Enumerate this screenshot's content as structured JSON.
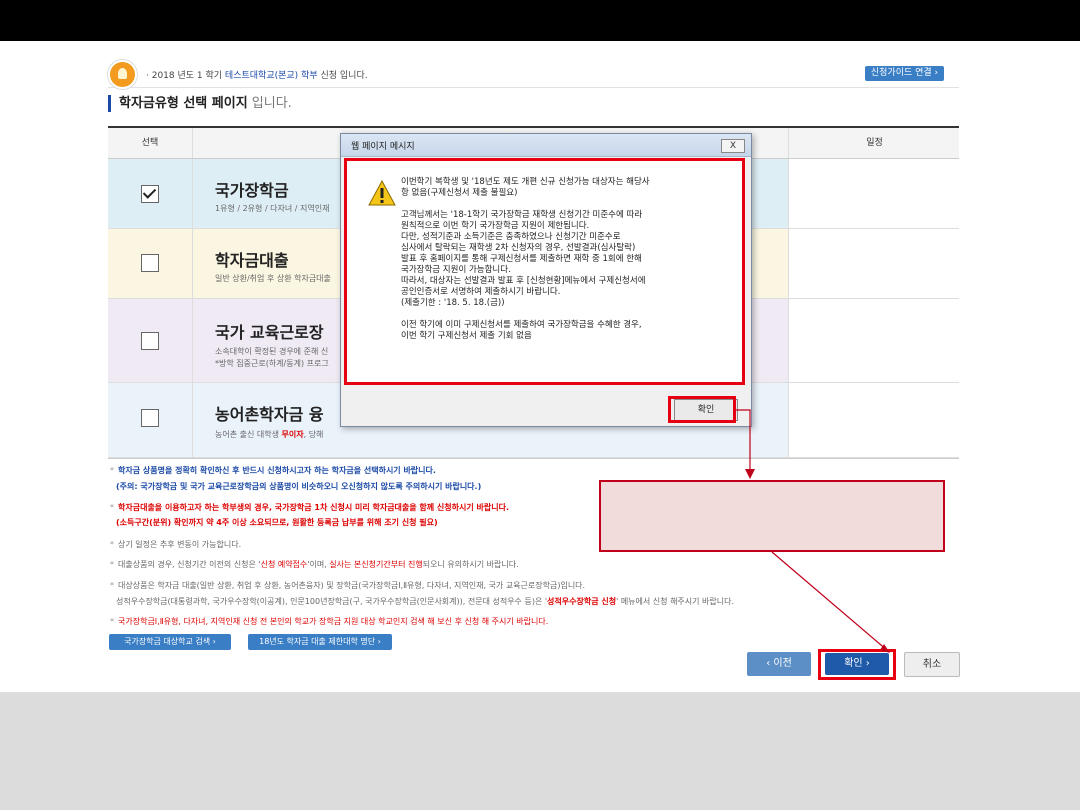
{
  "notice": {
    "prefix": "· 2018 년도 1 학기 ",
    "school": "테스트대학교(본교) 학부",
    "suffix": " 신청 입니다.",
    "guide_button": "신청가이드 연결 ›"
  },
  "page_title": {
    "bold": "학자금유형 선택 페이지",
    "rest": " 입니다."
  },
  "table": {
    "headers": {
      "select": "선택",
      "schedule": "일정"
    },
    "rows": [
      {
        "name": "국가장학금",
        "desc": "1유형 / 2유형 / 다자녀 / 지역인재",
        "checked": true
      },
      {
        "name": "학자금대출",
        "desc": "일반 상환/취업 후 상환 학자금대출",
        "checked": false
      },
      {
        "name": "국가 교육근로장",
        "desc": "소속대학이 확정된 경우에 준해 신",
        "desc2": "*방학 집중근로(하계/동계) 프로그",
        "checked": false
      },
      {
        "name": "농어촌학자금 융",
        "desc_pre": "농어촌 출신 대학생 ",
        "desc_red": "무이자",
        "desc_post": ", 당해",
        "checked": false
      }
    ]
  },
  "dialog": {
    "title": "웹 페이지 메시지",
    "close": "X",
    "para1": [
      "이번학기 복학생 및 '18년도 제도 개편 신규 신청가능 대상자는 해당사",
      "항 없음(구제신청서 제출 불필요)"
    ],
    "para2": [
      "고객님께서는 '18-1학기 국가장학금 재학생 신청기간 미준수에 따라",
      "원칙적으로 이번 학기 국가장학금 지원이 제한됩니다.",
      "다만, 성적기준과 소득기준은 충족하였으나 신청기간 미준수로",
      "심사에서 탈락되는 재학생 2차 신청자의 경우, 선발결과(심사탈락)",
      "발표 후 홈페이지를 통해 구제신청서를 제출하면 재학 중 1회에 한해",
      "국가장학금 지원이 가능합니다.",
      "따라서, 대상자는 선발결과 발표 후 [신청현황]메뉴에서 구제신청서에",
      "공인인증서로 서명하여 제출하시기 바랍니다.",
      "(제출기한 : '18. 5. 18.(금))"
    ],
    "para3": [
      "이전 학기에 이미 구제신청서를 제출하여 국가장학금을 수혜한 경우,",
      "이번 학기 구제신청서 제출 기회 없음"
    ],
    "ok": "확인"
  },
  "notes": {
    "n1a": "학자금 상품명을 정확히 확인하신 후 반드시 신청하시고자 하는 학자금을 선택하시기 바랍니다.",
    "n1b": "(주의: 국가장학금 및 국가 교육근로장학금의 상품명이 비슷하오니 오신청하지 않도록 주의하시기 바랍니다.)",
    "n2a": "학자금대출을 이용하고자 하는 학부생의 경우, 국가장학금 1차 신청시 미리 학자금대출을 함께 신청하시기 바랍니다.",
    "n2b": "(소득구간(분위) 확인까지 약 4주 이상 소요되므로, 원활한 등록금 납부를 위해 조기 신청 필요)",
    "n3": "상기 일정은 추후 변동이 가능합니다.",
    "n4a": "대출상품의 경우, 신청기간 이전의 신청은 '",
    "n4b": "신청 예약접수",
    "n4c": "'이며, ",
    "n4d": "실사는 본신청기간부터 진행",
    "n4e": "되오니 유의하시기 바랍니다.",
    "n5a": "대상상품은 학자금 대출(일반 상환, 취업 후 상환, 농어촌융자) 및 장학금(국가장학금Ⅰ,Ⅱ유형, 다자녀, 지역인재, 국가 교육근로장학금)입니다.",
    "n5b": "성적우수장학금(대통령과학, 국가우수장학(이공계), 인문100년장학금(구, 국가우수장학금(인문사회계)), 전문대 성적우수 등)은 '",
    "n5c": "성적우수장학금 신청",
    "n5d": "' 메뉴에서 신청 해주시기 바랍니다.",
    "n6": "국가장학금Ⅰ,Ⅱ유형, 다자녀, 지역인재 신청 전 본인의 학교가 장학금 지원 대상 학교인지 검색 해 보신 후 신청 해 주시기 바랍니다."
  },
  "buttons": {
    "search_school": "국가장학금 대상학교 검색 ›",
    "restricted": "18년도 학자금 대출 제한대학 명단 ›",
    "prev": "‹  이전",
    "confirm": "확인  ›",
    "cancel": "취소"
  },
  "colors": {
    "accent": "#1e5aa8",
    "highlight_frame": "#e60012",
    "callout_bg": "#f2dcdb"
  }
}
